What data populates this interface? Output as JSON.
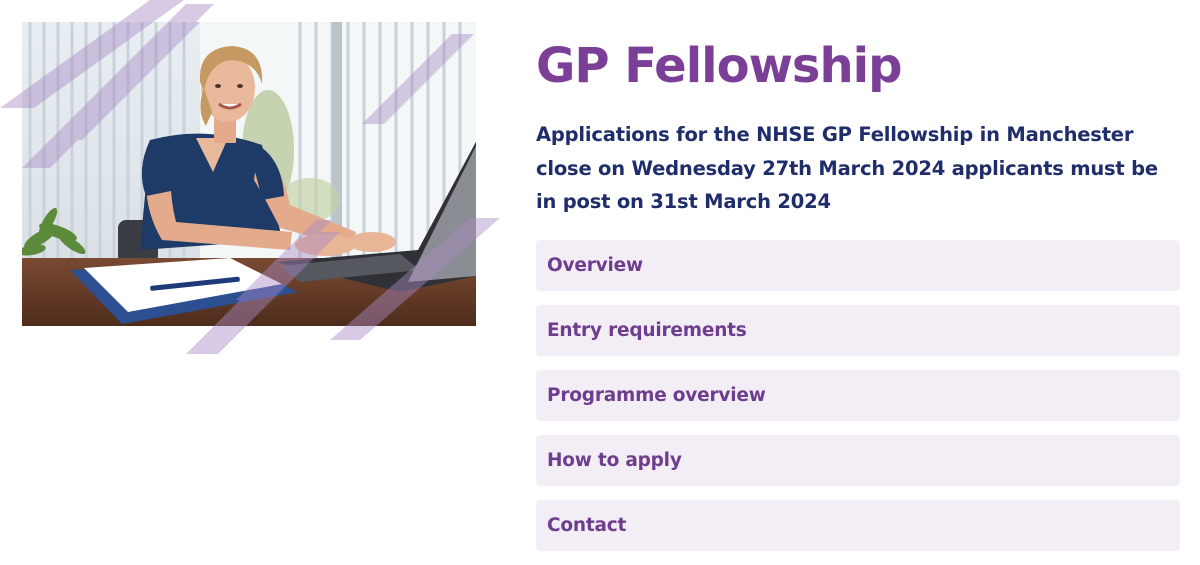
{
  "page": {
    "title": "GP Fellowship",
    "intro": "Applications for the NHSE GP Fellowship in Manchester close on Wednesday 27th March 2024 applicants must be in post on 31st March 2024"
  },
  "accordion": {
    "items": [
      {
        "label": "Overview"
      },
      {
        "label": "Entry requirements"
      },
      {
        "label": "Programme overview"
      },
      {
        "label": "How to apply"
      },
      {
        "label": "Contact"
      }
    ]
  },
  "colors": {
    "title": "#7b3f98",
    "intro": "#1f2d6b",
    "accordion_bg": "#f3eef6",
    "accordion_text": "#6e3d8e",
    "stripe": "#a98bc6"
  },
  "hero_image": {
    "subject": "woman in navy scrubs smiling while typing on a laptop at a desk"
  }
}
